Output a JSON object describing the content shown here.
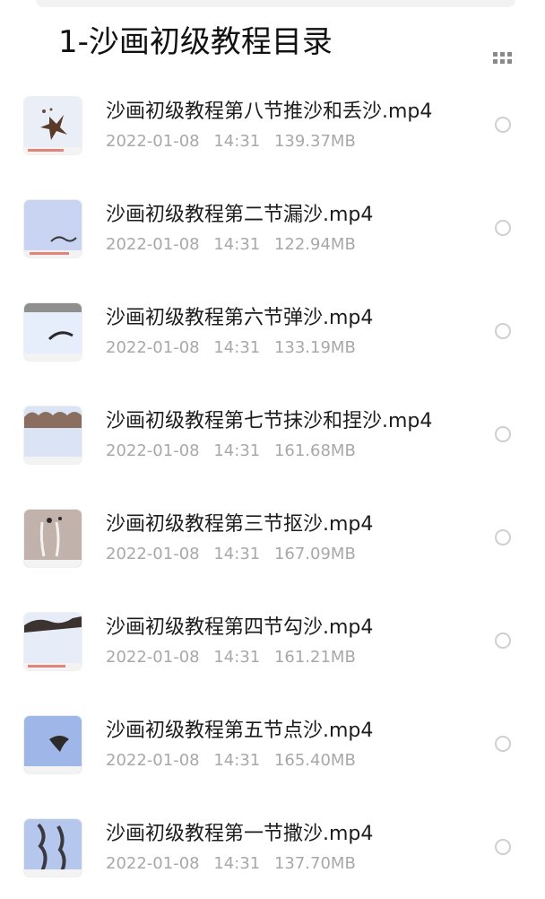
{
  "header": {
    "title": "1-沙画初级教程目录",
    "view_toggle_icon": "grid-view-icon"
  },
  "colors": {
    "background": "#ffffff",
    "title_text": "#111111",
    "filename_text": "#1c1c1c",
    "meta_text": "#a8a8a8",
    "radio_border": "#cfcfcf"
  },
  "files": [
    {
      "name": "沙画初级教程第八节推沙和丢沙.mp4",
      "date": "2022-01-08",
      "time": "14:31",
      "size": "139.37MB",
      "thumbnail_icon": "video-thumbnail-icon"
    },
    {
      "name": "沙画初级教程第二节漏沙.mp4",
      "date": "2022-01-08",
      "time": "14:31",
      "size": "122.94MB",
      "thumbnail_icon": "video-thumbnail-icon"
    },
    {
      "name": "沙画初级教程第六节弹沙.mp4",
      "date": "2022-01-08",
      "time": "14:31",
      "size": "133.19MB",
      "thumbnail_icon": "video-thumbnail-icon"
    },
    {
      "name": "沙画初级教程第七节抹沙和捏沙.mp4",
      "date": "2022-01-08",
      "time": "14:31",
      "size": "161.68MB",
      "thumbnail_icon": "video-thumbnail-icon"
    },
    {
      "name": "沙画初级教程第三节抠沙.mp4",
      "date": "2022-01-08",
      "time": "14:31",
      "size": "167.09MB",
      "thumbnail_icon": "video-thumbnail-icon"
    },
    {
      "name": "沙画初级教程第四节勾沙.mp4",
      "date": "2022-01-08",
      "time": "14:31",
      "size": "161.21MB",
      "thumbnail_icon": "video-thumbnail-icon"
    },
    {
      "name": "沙画初级教程第五节点沙.mp4",
      "date": "2022-01-08",
      "time": "14:31",
      "size": "165.40MB",
      "thumbnail_icon": "video-thumbnail-icon"
    },
    {
      "name": "沙画初级教程第一节撒沙.mp4",
      "date": "2022-01-08",
      "time": "14:31",
      "size": "137.70MB",
      "thumbnail_icon": "video-thumbnail-icon"
    }
  ]
}
